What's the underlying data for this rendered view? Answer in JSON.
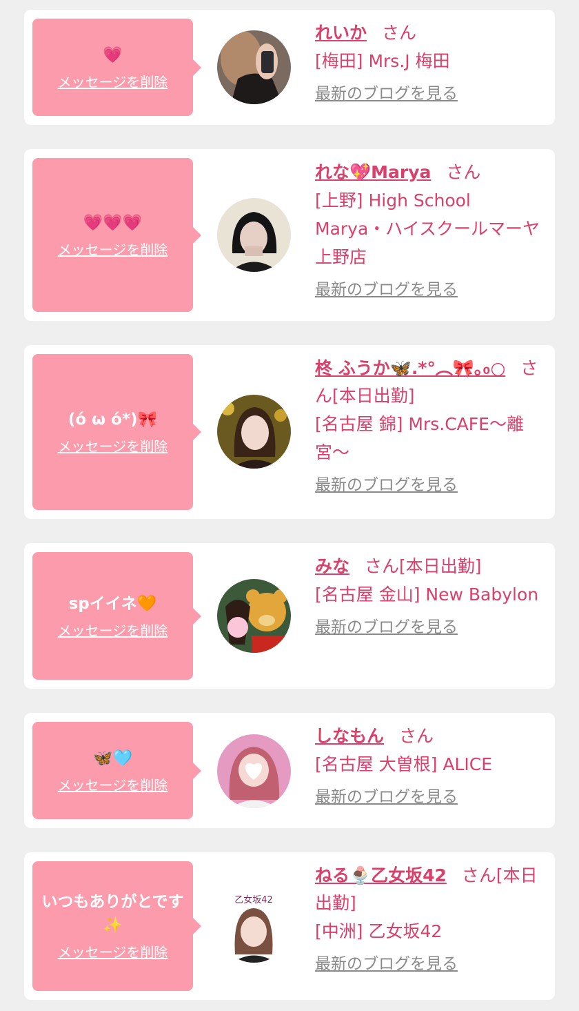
{
  "colors": {
    "background": "#efefef",
    "card": "#ffffff",
    "bubble": "#fb9bab",
    "accent": "#d9406a",
    "muted": "#8a8a8a"
  },
  "delete_label": "メッセージを削除",
  "blog_label": "最新のブログを見る",
  "cards": [
    {
      "message": "💗",
      "name": "れいか",
      "suffix": "さん",
      "shop": "[梅田] Mrs.J 梅田"
    },
    {
      "message": "💗💗💗",
      "name": "れな💖Marya",
      "suffix": "さん",
      "shop": "[上野] High School Marya・ハイスクールマーヤ上野店"
    },
    {
      "message": "(ό ω ό*)🎀",
      "name": "柊 ふうか🦋.*°︵🎀｡₀○",
      "suffix": "さん[本日出勤]",
      "shop": "[名古屋 錦] Mrs.CAFE〜離宮〜"
    },
    {
      "message": "spイイネ🧡",
      "name": "みな",
      "suffix": "さん[本日出勤]",
      "shop": "[名古屋 金山] New Babylon"
    },
    {
      "message": "🦋🩵",
      "name": "しなもん",
      "suffix": "さん",
      "shop": "[名古屋 大曽根] ALICE"
    },
    {
      "message": "いつもありがとです✨",
      "name": "ねる🍨乙女坂42",
      "suffix": "さん[本日出勤]",
      "shop": "[中洲] 乙女坂42",
      "avatar_logo": "乙女坂42"
    }
  ]
}
